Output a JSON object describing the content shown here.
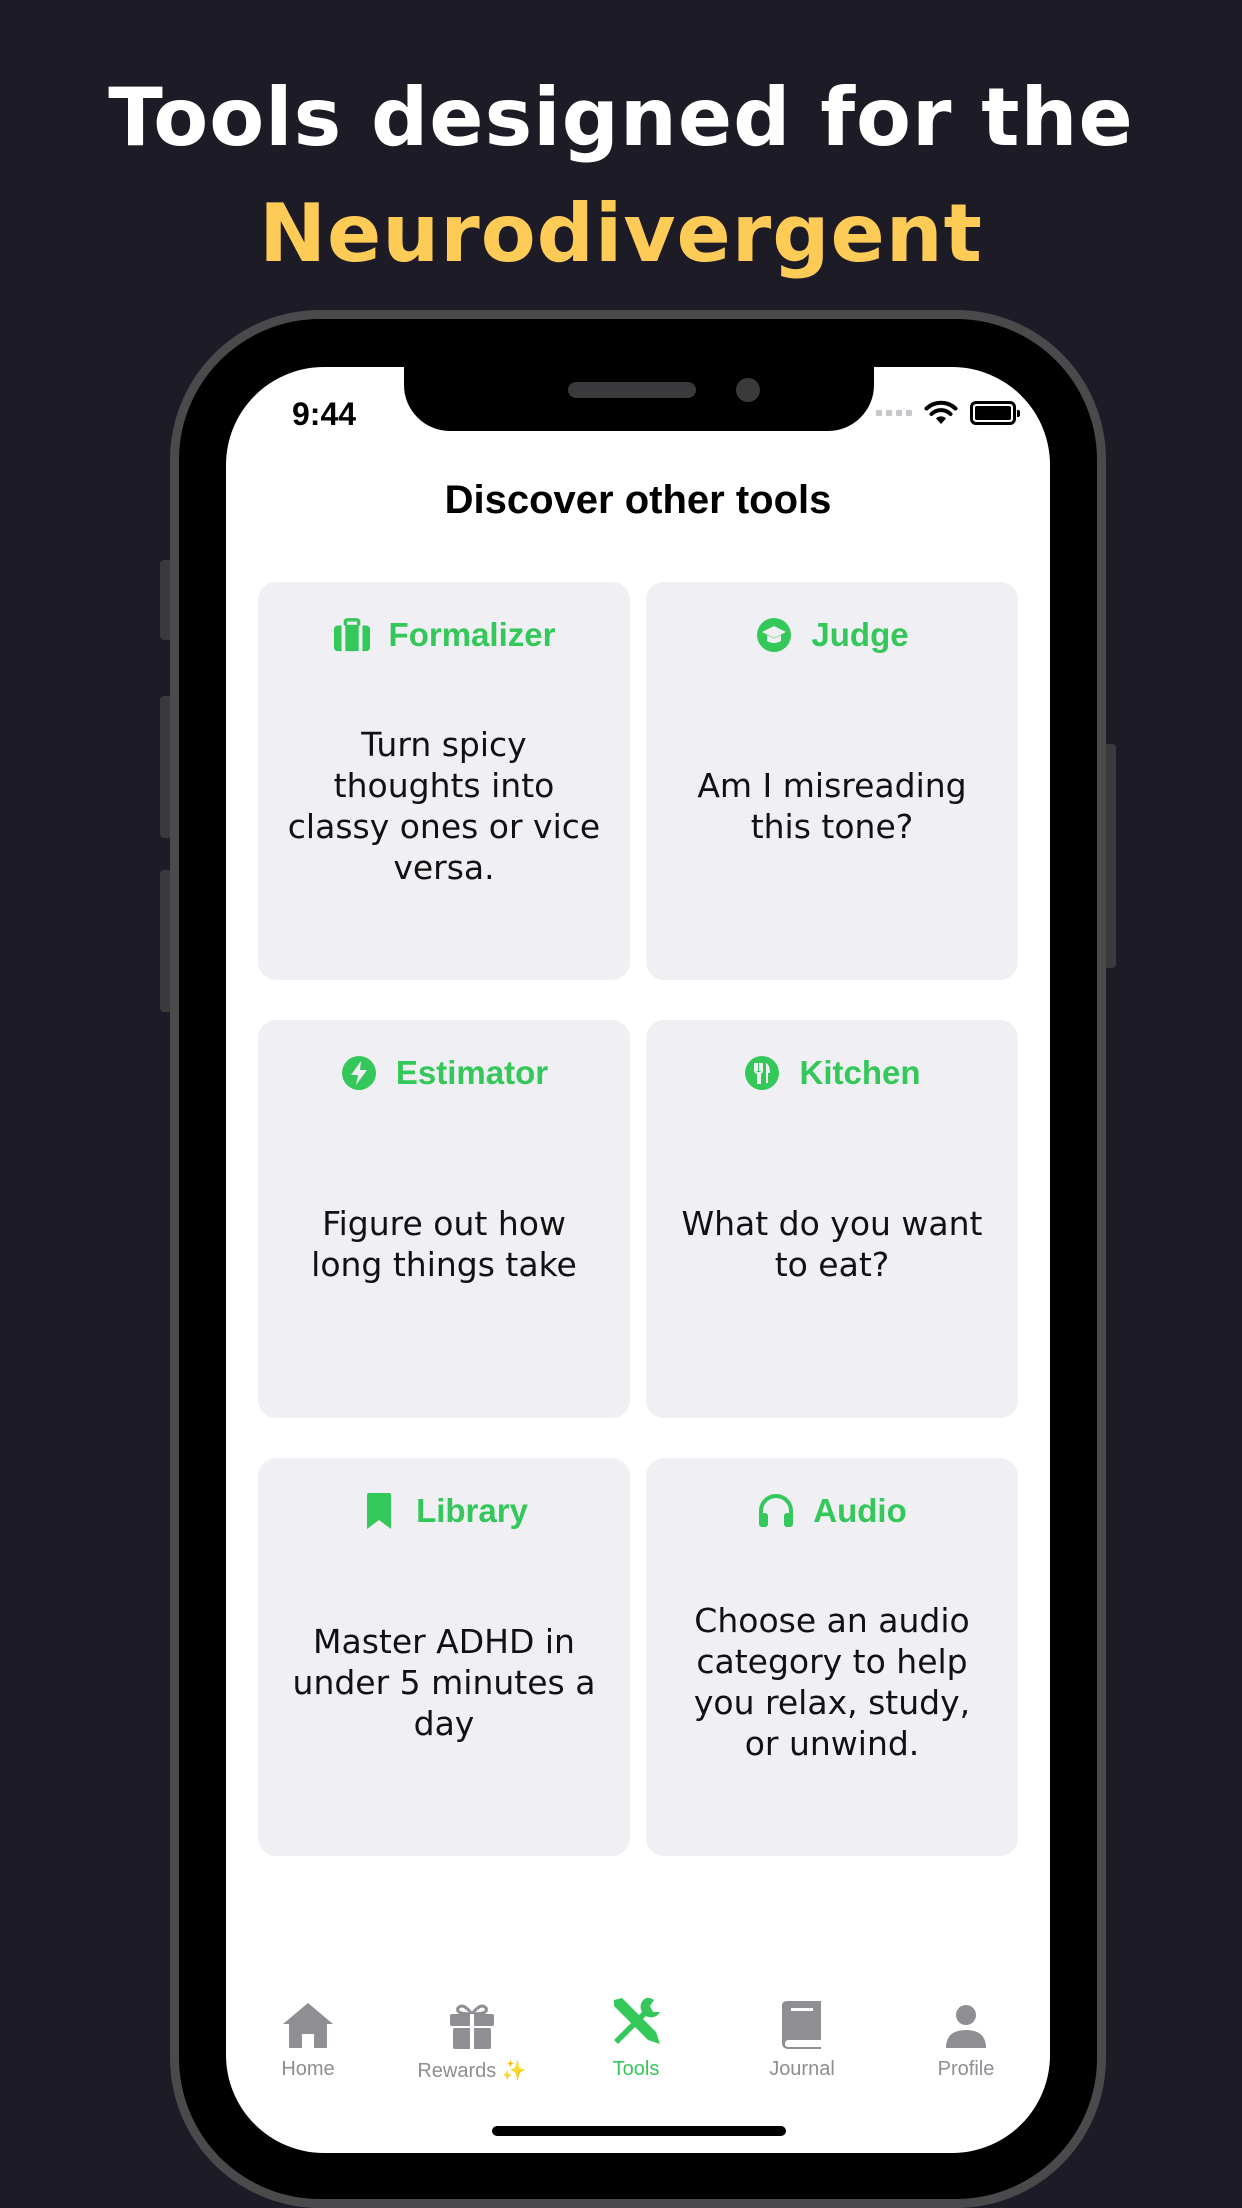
{
  "headline": {
    "line1": "Tools designed for the",
    "line2": "Neurodivergent",
    "accent_color": "#fecb57"
  },
  "status_bar": {
    "time": "9:44"
  },
  "page": {
    "title": "Discover other tools"
  },
  "accent_color": "#34c759",
  "tools": [
    {
      "title": "Formalizer",
      "icon": "briefcase-icon",
      "description": "Turn spicy thoughts into classy ones or vice versa."
    },
    {
      "title": "Judge",
      "icon": "graduation-cap-icon",
      "description": "Am I misreading this tone?"
    },
    {
      "title": "Estimator",
      "icon": "bolt-icon",
      "description": "Figure out how long things take"
    },
    {
      "title": "Kitchen",
      "icon": "utensils-icon",
      "description": "What do you want to eat?"
    },
    {
      "title": "Library",
      "icon": "bookmark-icon",
      "description": "Master ADHD in under 5 minutes a day"
    },
    {
      "title": "Audio",
      "icon": "headphones-icon",
      "description": "Choose an audio category to help you relax, study, or unwind."
    }
  ],
  "tab_bar": {
    "active": "Tools",
    "items": [
      {
        "label": "Home",
        "icon": "home-icon"
      },
      {
        "label": "Rewards ✨",
        "icon": "gift-icon"
      },
      {
        "label": "Tools",
        "icon": "tools-icon"
      },
      {
        "label": "Journal",
        "icon": "book-icon"
      },
      {
        "label": "Profile",
        "icon": "person-icon"
      }
    ]
  }
}
